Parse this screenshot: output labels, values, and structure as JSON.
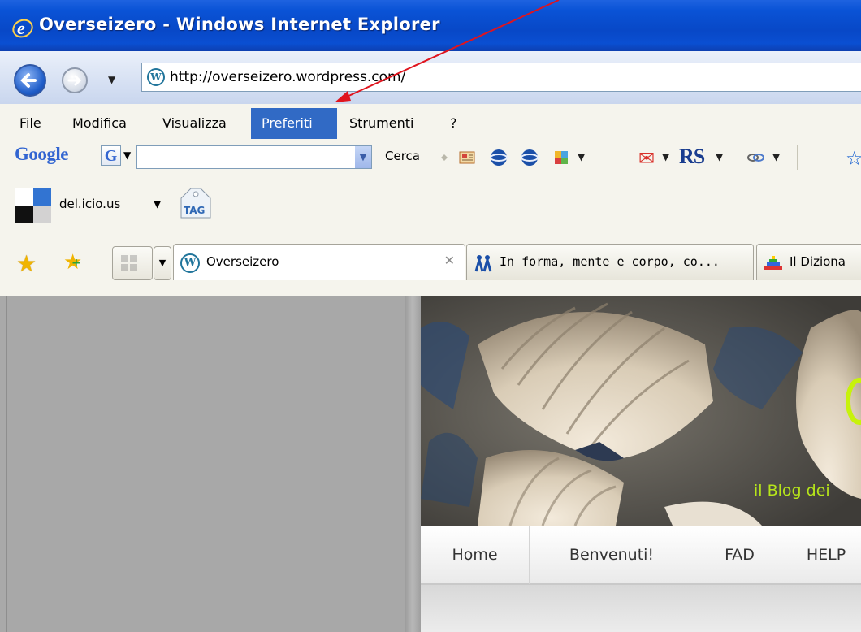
{
  "window": {
    "title": "Overseizero - Windows Internet Explorer"
  },
  "address": {
    "url": "http://overseizero.wordpress.com/"
  },
  "menu": {
    "items": [
      "File",
      "Modifica",
      "Visualizza",
      "Preferiti",
      "Strumenti",
      "?"
    ],
    "active": "Preferiti"
  },
  "google_toolbar": {
    "logo": "Google",
    "search_button": "Cerca",
    "rs_label": "RS"
  },
  "delicious_toolbar": {
    "label": "del.icio.us",
    "tag_label": "TAG"
  },
  "tabs": [
    {
      "title": "Overseizero",
      "active": true
    },
    {
      "title": "In forma, mente e corpo, co..."
    },
    {
      "title": "Il Diziona"
    }
  ],
  "page": {
    "tagline": "il Blog dei",
    "nav": [
      "Home",
      "Benvenuti!",
      "FAD",
      "HELP"
    ]
  },
  "colors": {
    "titlebar": "#0a53d6",
    "menu_active": "#316ac5",
    "tagline": "#b6e51a",
    "annotation_arrow": "#e0141e"
  }
}
